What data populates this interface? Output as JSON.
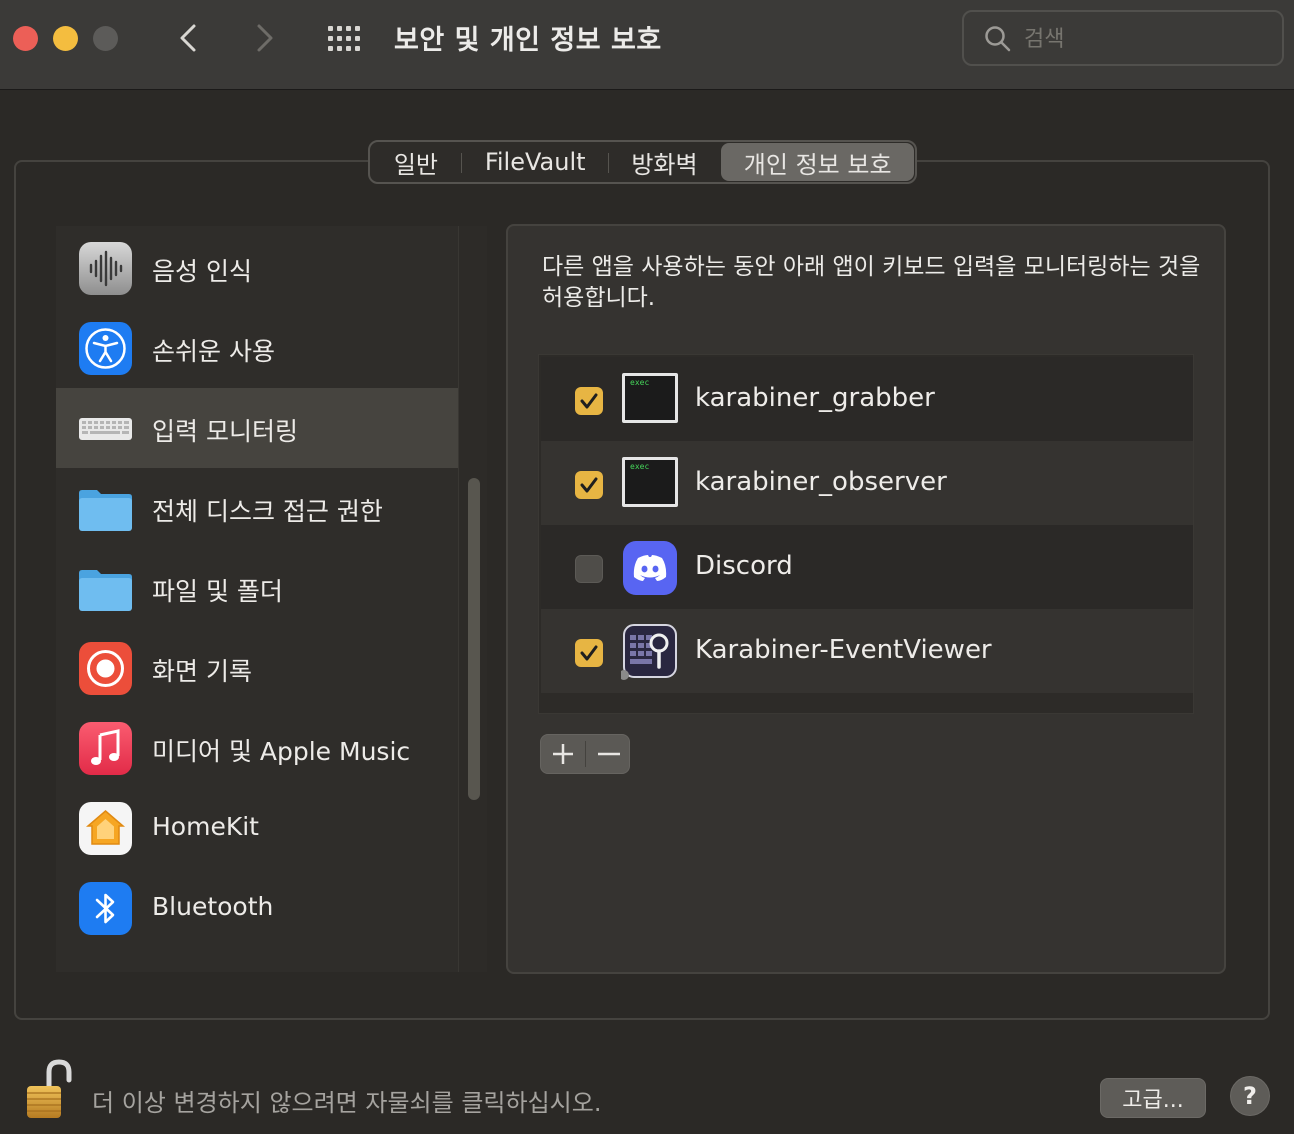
{
  "window": {
    "title": "보안 및 개인 정보 보호",
    "search_placeholder": "검색"
  },
  "tabs": [
    {
      "label": "일반",
      "active": false
    },
    {
      "label": "FileVault",
      "active": false
    },
    {
      "label": "방화벽",
      "active": false
    },
    {
      "label": "개인 정보 보호",
      "active": true
    }
  ],
  "sidebar": {
    "items": [
      {
        "label": "음성 인식",
        "icon": "waveform-icon"
      },
      {
        "label": "손쉬운 사용",
        "icon": "accessibility-icon"
      },
      {
        "label": "입력 모니터링",
        "icon": "keyboard-icon",
        "selected": true
      },
      {
        "label": "전체 디스크 접근 권한",
        "icon": "folder-icon"
      },
      {
        "label": "파일 및 폴더",
        "icon": "folder-icon"
      },
      {
        "label": "화면 기록",
        "icon": "screen-record-icon"
      },
      {
        "label": "미디어 및 Apple Music",
        "icon": "music-note-icon"
      },
      {
        "label": "HomeKit",
        "icon": "home-icon"
      },
      {
        "label": "Bluetooth",
        "icon": "bluetooth-icon"
      }
    ]
  },
  "panel": {
    "description": "다른 앱을 사용하는 동안 아래 앱이 키보드 입력을 모니터링하는 것을 허용합니다.",
    "apps": [
      {
        "name": "karabiner_grabber",
        "checked": true,
        "icon": "exec-terminal-icon",
        "icon_text": "exec"
      },
      {
        "name": "karabiner_observer",
        "checked": true,
        "icon": "exec-terminal-icon",
        "icon_text": "exec"
      },
      {
        "name": "Discord",
        "checked": false,
        "icon": "discord-icon"
      },
      {
        "name": "Karabiner-EventViewer",
        "checked": true,
        "icon": "event-viewer-icon"
      }
    ],
    "add_label": "+",
    "remove_label": "−"
  },
  "footer": {
    "lock_text": "더 이상 변경하지 않으려면 자물쇠를 클릭하십시오.",
    "advanced_label": "고급...",
    "help_label": "?"
  },
  "colors": {
    "checkbox_on": "#e7b543",
    "selected_row": "#46443f",
    "active_tab": "#6a6864"
  }
}
